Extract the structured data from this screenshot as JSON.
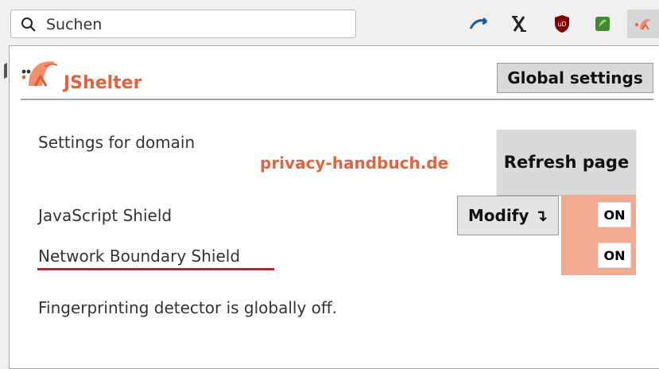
{
  "browser": {
    "search_placeholder": "Suchen",
    "extensions": [
      "arrow-ext-icon",
      "x-ext-icon",
      "ublock-icon",
      "green-ext-icon",
      "jshelter-icon"
    ]
  },
  "popup": {
    "brand_name": "JShelter",
    "global_settings_label": "Global settings",
    "settings_for_domain_label": "Settings for domain",
    "domain": "privacy-handbuch.de",
    "refresh_label": "Refresh page",
    "javascript_shield_label": "JavaScript Shield",
    "modify_label": "Modify ↴",
    "network_shield_label": "Network Boundary Shield",
    "javascript_shield_state": "ON",
    "network_shield_state": "ON",
    "fingerprint_status": "Fingerprinting detector is globally off."
  },
  "colors": {
    "brand": "#e2643e",
    "toggle_bg": "#f3aa91",
    "underline": "#e0121f"
  }
}
